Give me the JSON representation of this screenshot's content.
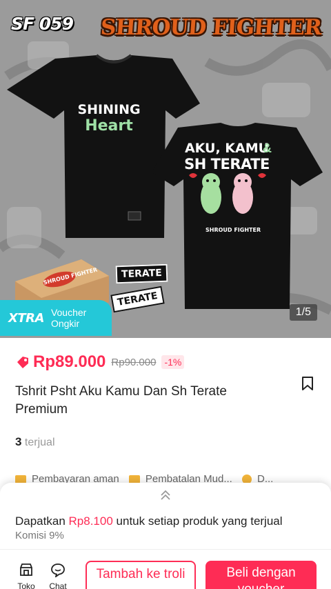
{
  "hero": {
    "sku": "SF 059",
    "brand": "SHROUD FIGHTER",
    "front_print_line1": "SHINING",
    "front_print_line2": "Heart",
    "back_print_line1": "AKU, KAMU",
    "back_print_amp": "&",
    "back_print_line2": "SH TERATE",
    "back_print_small": "SHROUD FIGHTER",
    "box_label": "SHROUD FIGHTER",
    "sticker1": "TERATE",
    "sticker2": "TERATE",
    "badge_logo": "XTRA",
    "badge_line1": "Voucher",
    "badge_line2": "Ongkir",
    "pager": "1/5"
  },
  "product": {
    "price": "Rp89.000",
    "price_original": "Rp90.000",
    "discount": "-1%",
    "title": "Tshrit Psht Aku Kamu Dan Sh Terate Premium",
    "sold_count": "3",
    "sold_label": "terjual"
  },
  "assurances": [
    {
      "icon": "card-icon",
      "label": "Pembayaran aman"
    },
    {
      "icon": "folder-icon",
      "label": "Pembatalan Mud..."
    },
    {
      "icon": "coin-icon",
      "label": "D..."
    }
  ],
  "affiliate": {
    "prefix": "Dapatkan",
    "amount": "Rp8.100",
    "suffix": "untuk setiap produk yang terjual",
    "commission": "Komisi 9%"
  },
  "bottom_bar": {
    "shop_label": "Toko",
    "chat_label": "Chat",
    "cart_label": "Tambah ke troli",
    "buy_label": "Beli dengan voucher"
  },
  "colors": {
    "accent": "#fe2c55",
    "xtra": "#24c8d8"
  }
}
